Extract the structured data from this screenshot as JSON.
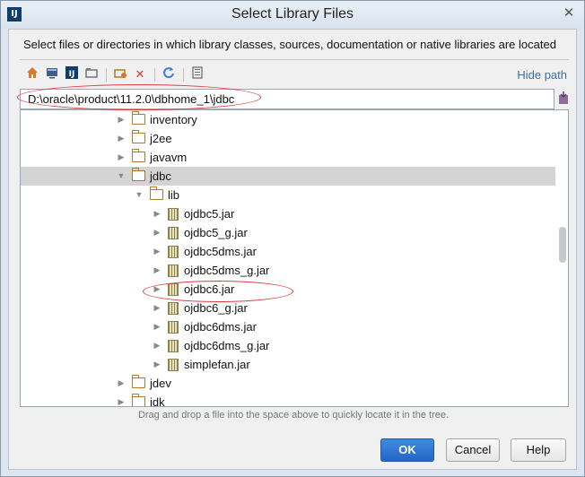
{
  "window": {
    "title": "Select Library Files",
    "app_icon_glyph": "IJ",
    "close_glyph": "✕"
  },
  "description": "Select files or directories in which library classes, sources, documentation or native libraries are located",
  "toolbar": {
    "icons": [
      "home-icon",
      "desktop-icon",
      "project-icon",
      "module-folder-icon",
      "new-folder-icon",
      "delete-icon",
      "refresh-icon",
      "show-hidden-icon"
    ],
    "hide_path_label": "Hide path"
  },
  "path": {
    "value": "D:\\oracle\\product\\11.2.0\\dbhome_1\\jdbc"
  },
  "tree": {
    "items": [
      {
        "label": "inventory",
        "type": "folder",
        "depth": 0,
        "arrow": "collapsed"
      },
      {
        "label": "j2ee",
        "type": "folder",
        "depth": 0,
        "arrow": "collapsed"
      },
      {
        "label": "javavm",
        "type": "folder",
        "depth": 0,
        "arrow": "collapsed"
      },
      {
        "label": "jdbc",
        "type": "folder",
        "depth": 0,
        "arrow": "expanded",
        "selected": true
      },
      {
        "label": "lib",
        "type": "folder",
        "depth": 1,
        "arrow": "expanded"
      },
      {
        "label": "ojdbc5.jar",
        "type": "jar",
        "depth": 2,
        "arrow": "collapsed"
      },
      {
        "label": "ojdbc5_g.jar",
        "type": "jar",
        "depth": 2,
        "arrow": "collapsed"
      },
      {
        "label": "ojdbc5dms.jar",
        "type": "jar",
        "depth": 2,
        "arrow": "collapsed"
      },
      {
        "label": "ojdbc5dms_g.jar",
        "type": "jar",
        "depth": 2,
        "arrow": "collapsed"
      },
      {
        "label": "ojdbc6.jar",
        "type": "jar",
        "depth": 2,
        "arrow": "collapsed",
        "highlighted": true
      },
      {
        "label": "ojdbc6_g.jar",
        "type": "jar",
        "depth": 2,
        "arrow": "collapsed"
      },
      {
        "label": "ojdbc6dms.jar",
        "type": "jar",
        "depth": 2,
        "arrow": "collapsed"
      },
      {
        "label": "ojdbc6dms_g.jar",
        "type": "jar",
        "depth": 2,
        "arrow": "collapsed"
      },
      {
        "label": "simplefan.jar",
        "type": "jar",
        "depth": 2,
        "arrow": "collapsed"
      },
      {
        "label": "jdev",
        "type": "folder",
        "depth": 0,
        "arrow": "collapsed"
      },
      {
        "label": "jdk",
        "type": "folder",
        "depth": 0,
        "arrow": "collapsed"
      }
    ]
  },
  "hint": "Drag and drop a file into the space above to quickly locate it in the tree.",
  "buttons": {
    "ok": "OK",
    "cancel": "Cancel",
    "help": "Help"
  },
  "colors": {
    "primary_button": "#2b72d0",
    "annotation_ellipse": "#d94040",
    "selected_row": "#d4d4d4"
  }
}
